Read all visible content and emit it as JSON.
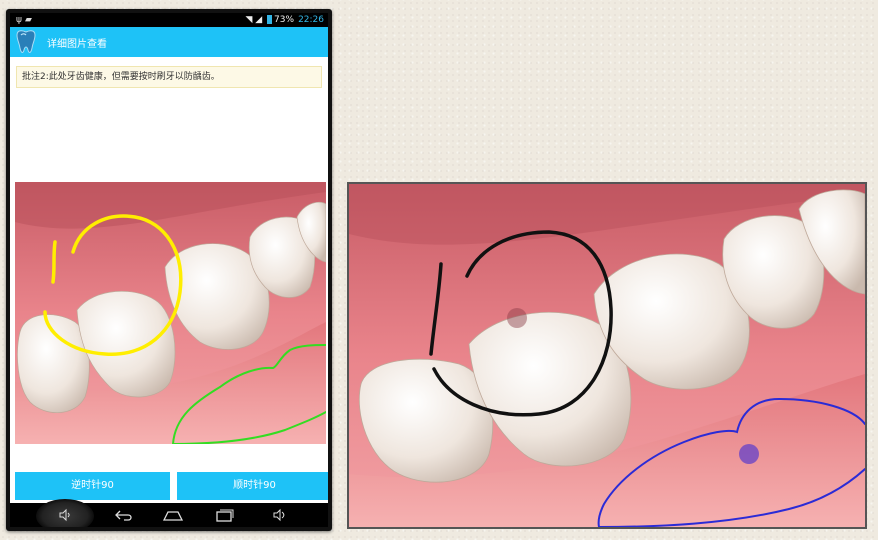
{
  "status_bar": {
    "left_icons": [
      "usb-icon",
      "debug-icon"
    ],
    "battery": "73%",
    "time": "22:26"
  },
  "action_bar": {
    "title": "详细图片查看",
    "icon": "tooth-icon"
  },
  "note": {
    "text": "批注2:此处牙齿健康，但需要按时刷牙以防龋齿。"
  },
  "buttons": {
    "rotate_ccw": "逆时针90",
    "rotate_cw": "顺时针90"
  },
  "nav_bar": {
    "icons": [
      "volume-down-icon",
      "back-icon",
      "home-icon",
      "recent-apps-icon",
      "volume-up-icon"
    ]
  },
  "colors": {
    "accent": "#1ec2f7",
    "note_bg": "#fdf9e6",
    "annotation_yellow": "#ffee00",
    "annotation_green": "#33dd22",
    "annotation_black": "#111111",
    "annotation_blue": "#2b2bd6"
  }
}
